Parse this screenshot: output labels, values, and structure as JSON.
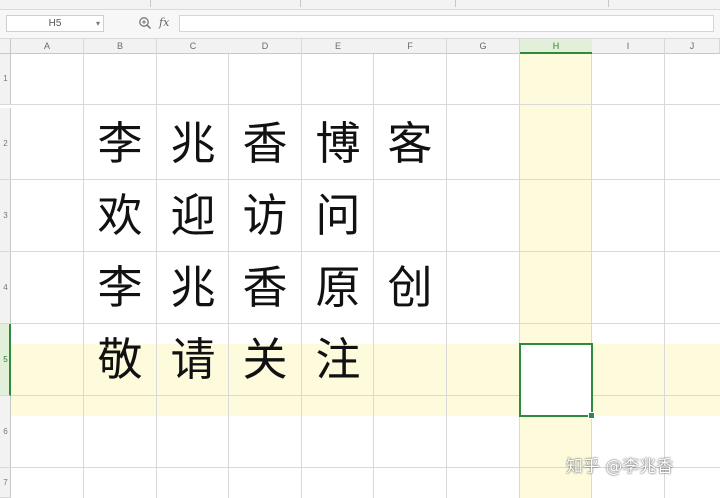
{
  "formula_bar": {
    "name_box": "H5",
    "fx_label": "fx",
    "formula_value": ""
  },
  "columns": [
    "A",
    "B",
    "C",
    "D",
    "E",
    "F",
    "G",
    "H",
    "I",
    "J"
  ],
  "active_column": "H",
  "rows": [
    "1",
    "2",
    "3",
    "4",
    "5",
    "6",
    "7"
  ],
  "active_row": "5",
  "cells": {
    "B2": "李",
    "C2": "兆",
    "D2": "香",
    "E2": "博",
    "F2": "客",
    "B3": "欢",
    "C3": "迎",
    "D3": "访",
    "E3": "问",
    "B4": "李",
    "C4": "兆",
    "D4": "香",
    "E4": "原",
    "F4": "创",
    "B5": "敬",
    "C5": "请",
    "D5": "关",
    "E5": "注"
  },
  "selected_cell": "H5",
  "watermark": "知乎 @李兆香",
  "colors": {
    "highlight": "#fdfbdc",
    "selection": "#2e8b3e",
    "gridline": "#d9d9d9"
  }
}
